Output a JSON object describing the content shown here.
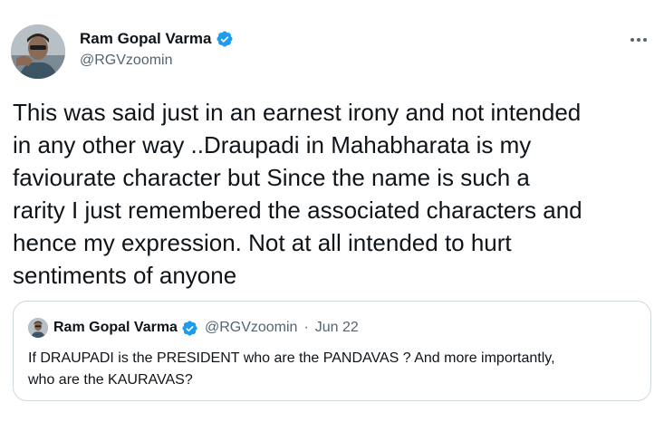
{
  "author": {
    "name": "Ram Gopal Varma",
    "handle": "@RGVzoomin",
    "verified": true,
    "avatar_icon": "profile-photo"
  },
  "tweet": {
    "text": "This was said just in an earnest irony and not intended\nin any other way ..Draupadi in Mahabharata is my\nfaviourate character but Since the name is such a\nrarity I just remembered the associated characters and\nhence my expression. Not at all intended to hurt\nsentiments of anyone"
  },
  "more_icon": "more-horizontal-icon",
  "colors": {
    "verified_blue": "#1d9bf0",
    "text_primary": "#0f1419",
    "text_secondary": "#536471",
    "border": "#cfd9de"
  },
  "quoted_tweet": {
    "name": "Ram Gopal Varma",
    "handle": "@RGVzoomin",
    "separator": "·",
    "date": "Jun 22",
    "text": "If DRAUPADI is the PRESIDENT who are the PANDAVAS ? And more importantly,\nwho are the KAURAVAS?"
  }
}
